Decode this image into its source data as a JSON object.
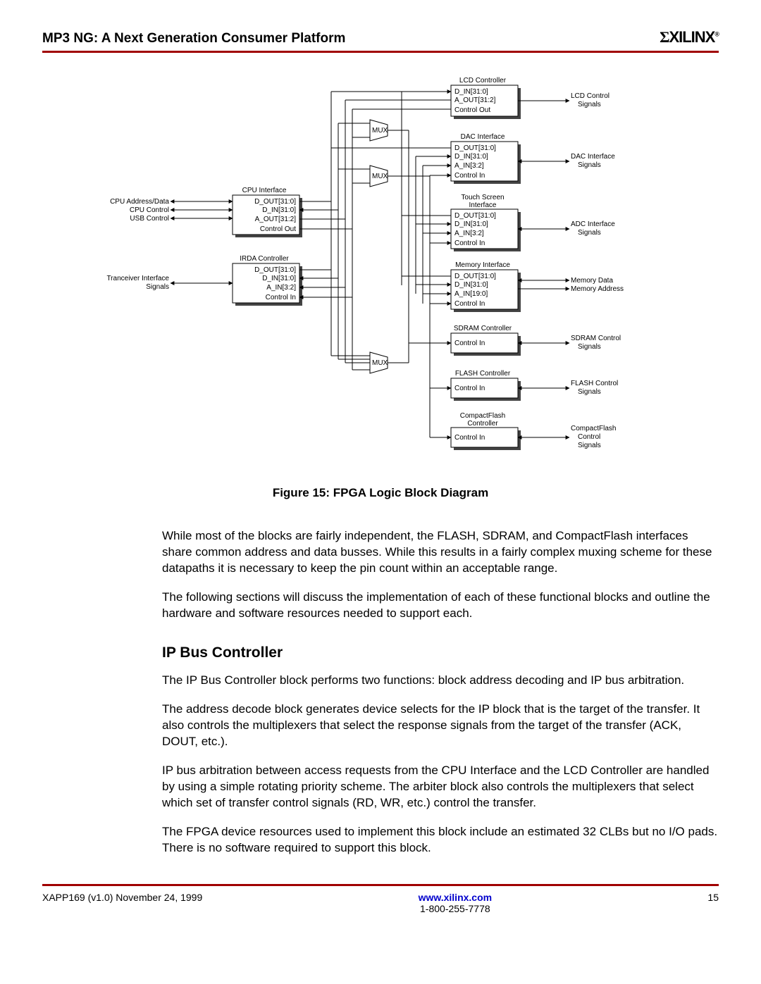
{
  "header": {
    "title": "MP3 NG: A Next Generation Consumer Platform",
    "brand": "XILINX",
    "reg": "®"
  },
  "figure": {
    "caption": "Figure 15:  FPGA Logic Block Diagram",
    "blocks": {
      "cpu": {
        "title": "CPU Interface",
        "rows": [
          "D_OUT[31:0]",
          "D_IN[31:0]",
          "A_OUT[31:2]",
          "Control Out"
        ],
        "ext": [
          "CPU Address/Data",
          "CPU Control",
          "USB Control"
        ]
      },
      "irda": {
        "title": "IRDA Controller",
        "rows": [
          "D_OUT[31:0]",
          "D_IN[31:0]",
          "A_IN[3:2]",
          "Control In"
        ],
        "ext": [
          "Tranceiver Interface",
          "Signals"
        ]
      },
      "lcd": {
        "title": "LCD Controller",
        "rows": [
          "D_IN[31:0]",
          "A_OUT[31:2]",
          "Control Out"
        ],
        "ext": [
          "LCD Control",
          "Signals"
        ]
      },
      "dac": {
        "title": "DAC Interface",
        "rows": [
          "D_OUT[31:0]",
          "D_IN[31:0]",
          "A_IN[3:2]",
          "Control In"
        ],
        "ext": [
          "DAC Interface",
          "Signals"
        ]
      },
      "touch": {
        "title": "Touch Screen",
        "title2": "Interface",
        "rows": [
          "D_OUT[31:0]",
          "D_IN[31:0]",
          "A_IN[3:2]",
          "Control In"
        ],
        "ext": [
          "ADC Interface",
          "Signals"
        ]
      },
      "mem": {
        "title": "Memory Interface",
        "rows": [
          "D_OUT[31:0]",
          "D_IN[31:0]",
          "A_IN[19:0]",
          "Control In"
        ],
        "ext": [
          "Memory Data",
          "Memory Address"
        ]
      },
      "sdram": {
        "title": "SDRAM Controller",
        "rows": [
          "Control In"
        ],
        "ext": [
          "SDRAM Control",
          "Signals"
        ]
      },
      "flash": {
        "title": "FLASH Controller",
        "rows": [
          "Control In"
        ],
        "ext": [
          "FLASH Control",
          "Signals"
        ]
      },
      "cf": {
        "title": "CompactFlash",
        "title2": "Controller",
        "rows": [
          "Control In"
        ],
        "ext": [
          "CompactFlash",
          "Control",
          "Signals"
        ]
      }
    },
    "mux": "MUX"
  },
  "paragraphs": {
    "p1": "While most of the blocks are fairly independent, the FLASH, SDRAM, and CompactFlash interfaces share common address and data busses. While this results in a fairly complex muxing scheme for these datapaths it is necessary to keep the pin count within an acceptable range.",
    "p2": "The following sections will discuss the implementation of each of these functional blocks and outline the hardware and software resources needed to support each.",
    "h": "IP Bus Controller",
    "p3": "The IP Bus Controller block performs two functions: block address decoding and IP bus arbitration.",
    "p4": "The address decode block generates device selects for the IP block that is the target of the transfer. It also controls the multiplexers that select the response signals from the target of the transfer (ACK, DOUT, etc.).",
    "p5": "IP bus arbitration between access requests from the CPU Interface and the LCD Controller are handled by using a simple rotating priority scheme. The arbiter block also controls the multiplexers that select which set of transfer control signals (RD, WR, etc.) control the transfer.",
    "p6": "The FPGA device resources used to implement this block include an estimated 32 CLBs but no I/O pads. There is no software required to support this block."
  },
  "footer": {
    "left": "XAPP169 (v1.0) November 24, 1999",
    "url": "www.xilinx.com",
    "phone": "1-800-255-7778",
    "page": "15"
  }
}
